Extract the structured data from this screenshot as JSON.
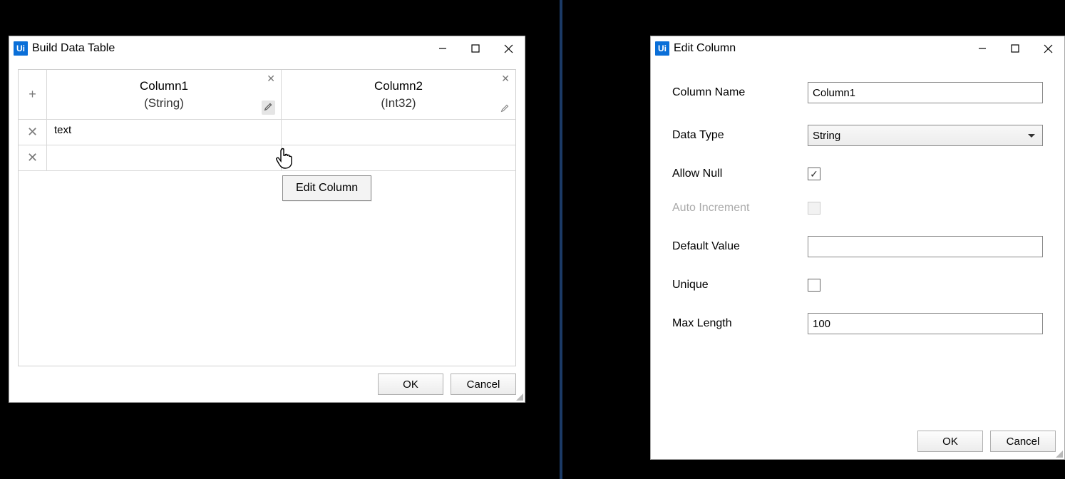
{
  "build": {
    "title": "Build Data Table",
    "tooltip": "Edit Column",
    "columns": [
      {
        "name": "Column1",
        "type": "(String)"
      },
      {
        "name": "Column2",
        "type": "(Int32)"
      }
    ],
    "rows": [
      {
        "c0": "text",
        "c1": ""
      },
      {
        "c0": "",
        "c1": ""
      }
    ],
    "ok": "OK",
    "cancel": "Cancel"
  },
  "edit": {
    "title": "Edit Column",
    "labels": {
      "columnName": "Column Name",
      "dataType": "Data Type",
      "allowNull": "Allow Null",
      "autoIncrement": "Auto Increment",
      "defaultValue": "Default Value",
      "unique": "Unique",
      "maxLength": "Max Length"
    },
    "values": {
      "columnName": "Column1",
      "dataType": "String",
      "allowNull": true,
      "autoIncrement": false,
      "defaultValue": "",
      "unique": false,
      "maxLength": "100"
    },
    "ok": "OK",
    "cancel": "Cancel"
  }
}
